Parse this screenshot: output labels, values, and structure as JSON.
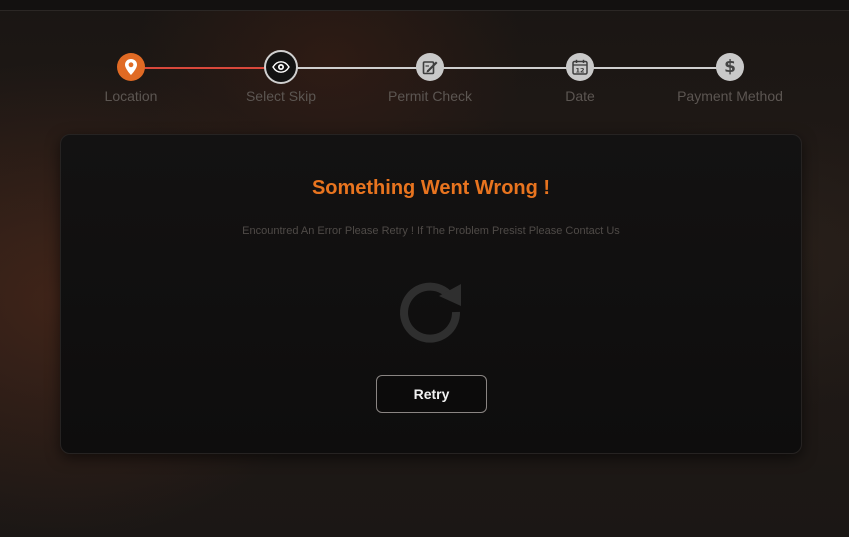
{
  "stepper": {
    "steps": [
      {
        "label": "Location",
        "icon": "location-pin-icon",
        "state": "done"
      },
      {
        "label": "Select Skip",
        "icon": "eye-icon",
        "state": "active"
      },
      {
        "label": "Permit Check",
        "icon": "edit-document-icon",
        "state": "pending"
      },
      {
        "label": "Date",
        "icon": "calendar-icon",
        "state": "pending",
        "icon_text": "12"
      },
      {
        "label": "Payment Method",
        "icon": "dollar-icon",
        "state": "pending",
        "icon_text": "$"
      }
    ]
  },
  "error_card": {
    "title": "Something Went Wrong !",
    "message": "Encountred An Error Please Retry ! If The Problem Presist Please Contact Us",
    "icon": "refresh-icon",
    "retry_label": "Retry"
  },
  "colors": {
    "accent": "#e06a24",
    "title": "#e8741f",
    "step_pending": "#c9c9c9",
    "step_label": "#5c5652",
    "progress_line": "#d9483b"
  }
}
